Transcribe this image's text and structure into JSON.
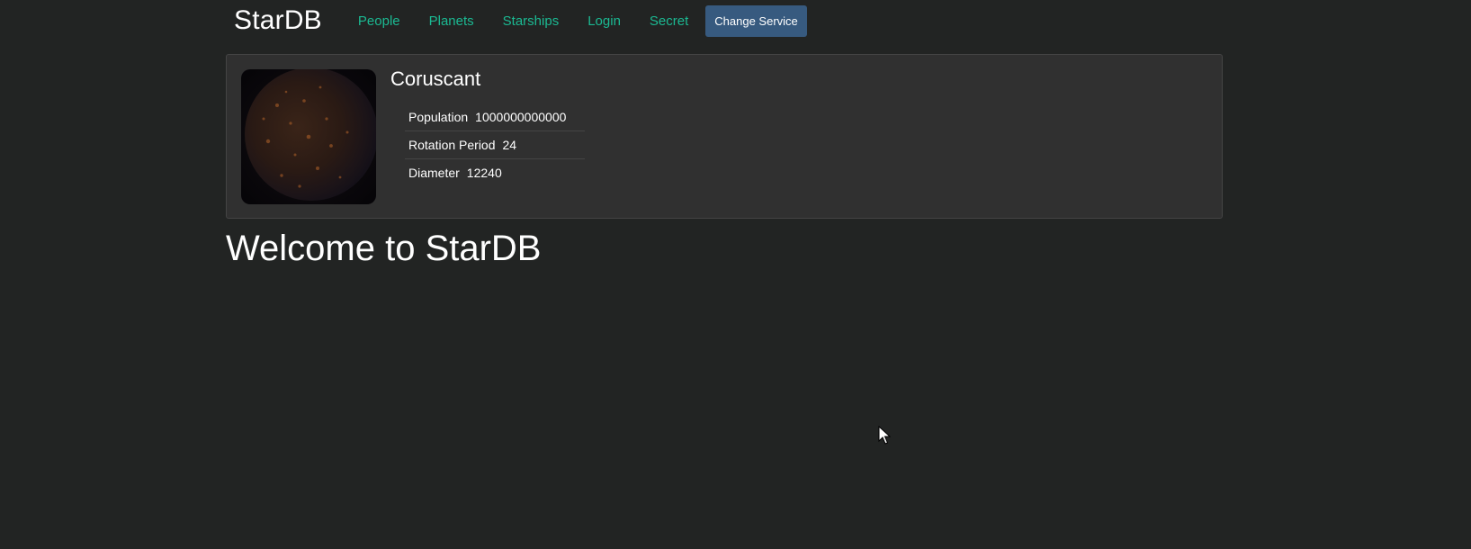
{
  "header": {
    "brand": "StarDB",
    "nav": [
      {
        "label": "People"
      },
      {
        "label": "Planets"
      },
      {
        "label": "Starships"
      },
      {
        "label": "Login"
      },
      {
        "label": "Secret"
      }
    ],
    "change_service_label": "Change Service"
  },
  "random_planet": {
    "name": "Coruscant",
    "image_icon": "planet-image",
    "details": [
      {
        "term": "Population",
        "value": "1000000000000"
      },
      {
        "term": "Rotation Period",
        "value": "24"
      },
      {
        "term": "Diameter",
        "value": "12240"
      }
    ]
  },
  "main": {
    "welcome": "Welcome to StarDB"
  },
  "colors": {
    "background": "#222423",
    "card": "#303030",
    "nav_link": "#1bb992",
    "button": "#375a7f"
  }
}
